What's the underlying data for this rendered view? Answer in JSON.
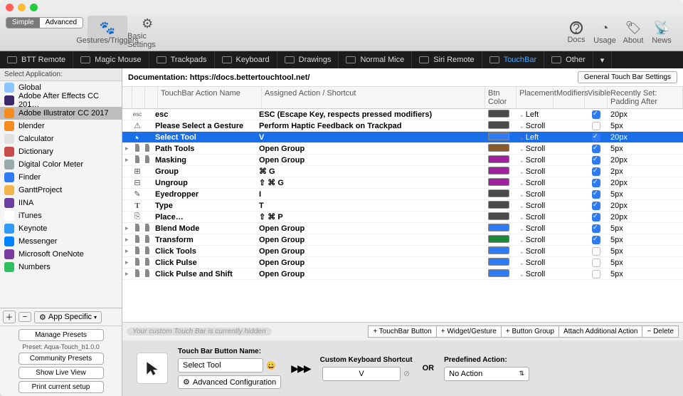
{
  "segmented": {
    "simple": "Simple",
    "advanced": "Advanced"
  },
  "toolbar": {
    "gestures": "Gestures/Triggers",
    "basic": "Basic Settings",
    "docs": "Docs",
    "usage": "Usage",
    "about": "About",
    "news": "News"
  },
  "devices": [
    "BTT Remote",
    "Magic Mouse",
    "Trackpads",
    "Keyboard",
    "Drawings",
    "Normal Mice",
    "Siri Remote",
    "TouchBar",
    "Other"
  ],
  "device_active": 7,
  "sidebar_header": "Select Application:",
  "apps": [
    {
      "name": "Global",
      "color": "#8cc4ff"
    },
    {
      "name": "Adobe After Effects CC 201…",
      "color": "#3b2a6b"
    },
    {
      "name": "Adobe Illustrator CC 2017",
      "color": "#f58b1f",
      "sel": true
    },
    {
      "name": "blender",
      "color": "#f58b1f"
    },
    {
      "name": "Calculator",
      "color": "#e0e0e0"
    },
    {
      "name": "Dictionary",
      "color": "#c94c4c"
    },
    {
      "name": "Digital Color Meter",
      "color": "#9aa"
    },
    {
      "name": "Finder",
      "color": "#2f7bf6"
    },
    {
      "name": "GanttProject",
      "color": "#f3b64c"
    },
    {
      "name": "IINA",
      "color": "#6b3fa0"
    },
    {
      "name": "iTunes",
      "color": "#fff"
    },
    {
      "name": "Keynote",
      "color": "#2f9bf6"
    },
    {
      "name": "Messenger",
      "color": "#0084ff"
    },
    {
      "name": "Microsoft OneNote",
      "color": "#7b3ca0"
    },
    {
      "name": "Numbers",
      "color": "#30c060"
    }
  ],
  "app_specific": "App Specific",
  "presets": {
    "manage": "Manage Presets",
    "preset_label": "Preset: Aqua-Touch_b1.0.0",
    "community": "Community Presets",
    "live": "Show Live View",
    "print": "Print current setup"
  },
  "doc_label": "Documentation: https://docs.bettertouchtool.net/",
  "general_btn": "General Touch Bar Settings",
  "columns": {
    "name": "TouchBar Action Name",
    "action": "Assigned Action / Shortcut",
    "color": "Btn Color",
    "placement": "Placement",
    "modifiers": "Modifiers",
    "visible": "Visible",
    "padding": "Recently Set: Padding After"
  },
  "rows": [
    {
      "exp": "",
      "icon": "esc",
      "name": "esc",
      "action": "ESC (Escape Key, respects pressed modifiers)",
      "color": "#4a4a4a",
      "place": "Left",
      "vis": true,
      "pad": "20px"
    },
    {
      "exp": "",
      "icon": "warn",
      "name": "Please Select a Gesture",
      "action": "Perform Haptic Feedback on Trackpad",
      "color": "#4a4a4a",
      "place": "Scroll",
      "vis": false,
      "pad": "5px"
    },
    {
      "exp": "",
      "icon": "cursor",
      "name": "Select Tool",
      "action": "V",
      "color": "#2f7bf6",
      "place": "Left",
      "vis": true,
      "pad": "20px",
      "sel": true
    },
    {
      "exp": "▸",
      "icon": "folder",
      "name": "Path Tools",
      "action": "Open Group",
      "color": "#8a5a2b",
      "place": "Scroll",
      "vis": true,
      "pad": "5px"
    },
    {
      "exp": "▸",
      "icon": "folder",
      "name": "Masking",
      "action": "Open Group",
      "color": "#a020a0",
      "place": "Scroll",
      "vis": true,
      "pad": "20px"
    },
    {
      "exp": "",
      "icon": "group",
      "name": "Group",
      "action": "⌘ G",
      "color": "#a020a0",
      "place": "Scroll",
      "vis": true,
      "pad": "2px"
    },
    {
      "exp": "",
      "icon": "ungroup",
      "name": "Ungroup",
      "action": "⇧ ⌘ G",
      "color": "#a020a0",
      "place": "Scroll",
      "vis": true,
      "pad": "20px"
    },
    {
      "exp": "",
      "icon": "eyedrop",
      "name": "Eyedropper",
      "action": "I",
      "color": "#4a4a4a",
      "place": "Scroll",
      "vis": true,
      "pad": "5px"
    },
    {
      "exp": "",
      "icon": "type",
      "name": "Type",
      "action": "T",
      "color": "#4a4a4a",
      "place": "Scroll",
      "vis": true,
      "pad": "20px"
    },
    {
      "exp": "",
      "icon": "place",
      "name": "Place…",
      "action": "⇧ ⌘ P",
      "color": "#4a4a4a",
      "place": "Scroll",
      "vis": true,
      "pad": "20px"
    },
    {
      "exp": "▸",
      "icon": "folder",
      "name": "Blend Mode",
      "action": "Open Group",
      "color": "#2f7bf6",
      "place": "Scroll",
      "vis": true,
      "pad": "5px"
    },
    {
      "exp": "▸",
      "icon": "folder",
      "name": "Transform",
      "action": "Open Group",
      "color": "#1a8a3a",
      "place": "Scroll",
      "vis": true,
      "pad": "5px"
    },
    {
      "exp": "▸",
      "icon": "folder",
      "name": "Click Tools",
      "action": "Open Group",
      "color": "#2f7bf6",
      "place": "Scroll",
      "vis": false,
      "pad": "5px"
    },
    {
      "exp": "▸",
      "icon": "folder",
      "name": "Click Pulse",
      "action": "Open Group",
      "color": "#2f7bf6",
      "place": "Scroll",
      "vis": false,
      "pad": "5px"
    },
    {
      "exp": "▸",
      "icon": "folder",
      "name": "Click Pulse and Shift",
      "action": "Open Group",
      "color": "#2f7bf6",
      "place": "Scroll",
      "vis": false,
      "pad": "5px"
    }
  ],
  "footer_btns": {
    "tb": "+ TouchBar Button",
    "wg": "+ Widget/Gesture",
    "bg": "+ Button Group",
    "attach": "Attach Additional Action",
    "del": "− Delete"
  },
  "hidden_msg": "Your custom Touch Bar is currently hidden",
  "editor": {
    "name_label": "Touch Bar Button Name:",
    "name_value": "Select Tool",
    "advconf": "Advanced Configuration",
    "shortcut_label": "Custom Keyboard Shortcut",
    "shortcut_value": "V",
    "or": "OR",
    "pred_label": "Predefined Action:",
    "pred_value": "No Action"
  }
}
